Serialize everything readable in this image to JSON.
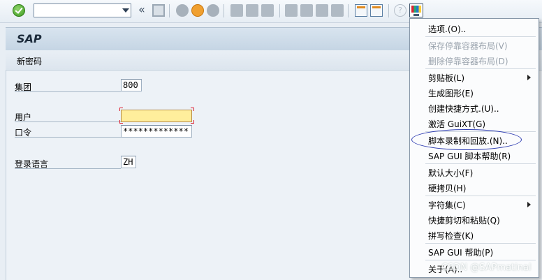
{
  "toolbar": {
    "command_field_value": "",
    "back_symbol": "«",
    "help_symbol": "?"
  },
  "header": {
    "title": "SAP",
    "subtitle": "新密码"
  },
  "form": {
    "client_label": "集团",
    "client_value": "800",
    "user_label": "用户",
    "user_value": "",
    "password_label": "口令",
    "password_value": "*************",
    "language_label": "登录语言",
    "language_value": "ZH"
  },
  "menu": {
    "items": [
      {
        "label": "选项.(O)..",
        "enabled": true
      },
      {
        "label": "保存停靠容器布局(V)",
        "enabled": false
      },
      {
        "label": "删除停靠容器布局(D)",
        "enabled": false
      },
      {
        "label": "剪贴板(L)",
        "enabled": true,
        "submenu": true
      },
      {
        "label": "生成图形(E)",
        "enabled": true
      },
      {
        "label": "创建快捷方式.(U)..",
        "enabled": true
      },
      {
        "label": "激活 GuiXT(G)",
        "enabled": true
      },
      {
        "label": "脚本录制和回放.(N)..",
        "enabled": true
      },
      {
        "label": "SAP GUI 脚本帮助(R)",
        "enabled": true
      },
      {
        "label": "默认大小(F)",
        "enabled": true
      },
      {
        "label": "硬拷贝(H)",
        "enabled": true
      },
      {
        "label": "字符集(C)",
        "enabled": true,
        "submenu": true
      },
      {
        "label": "快捷剪切和粘贴(Q)",
        "enabled": true
      },
      {
        "label": "拼写检查(K)",
        "enabled": true
      },
      {
        "label": "SAP GUI 帮助(P)",
        "enabled": true
      },
      {
        "label": "关于(A)..",
        "enabled": true
      }
    ]
  },
  "watermark": "CSDN @SAPmatinal",
  "colors": {
    "accent_blue": "#2b3ab0",
    "active_field": "#ffee9c"
  }
}
